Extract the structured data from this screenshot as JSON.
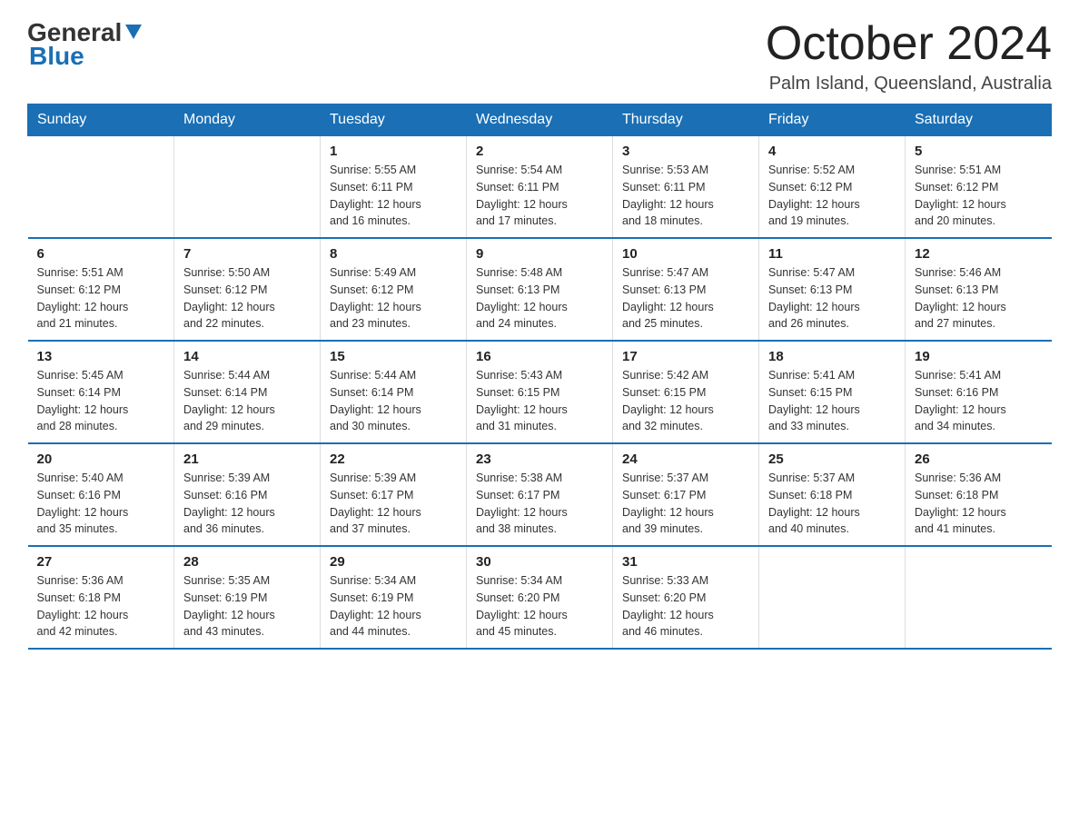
{
  "logo": {
    "general": "General",
    "blue": "Blue"
  },
  "title": "October 2024",
  "location": "Palm Island, Queensland, Australia",
  "days_of_week": [
    "Sunday",
    "Monday",
    "Tuesday",
    "Wednesday",
    "Thursday",
    "Friday",
    "Saturday"
  ],
  "weeks": [
    [
      {
        "num": "",
        "info": ""
      },
      {
        "num": "",
        "info": ""
      },
      {
        "num": "1",
        "info": "Sunrise: 5:55 AM\nSunset: 6:11 PM\nDaylight: 12 hours\nand 16 minutes."
      },
      {
        "num": "2",
        "info": "Sunrise: 5:54 AM\nSunset: 6:11 PM\nDaylight: 12 hours\nand 17 minutes."
      },
      {
        "num": "3",
        "info": "Sunrise: 5:53 AM\nSunset: 6:11 PM\nDaylight: 12 hours\nand 18 minutes."
      },
      {
        "num": "4",
        "info": "Sunrise: 5:52 AM\nSunset: 6:12 PM\nDaylight: 12 hours\nand 19 minutes."
      },
      {
        "num": "5",
        "info": "Sunrise: 5:51 AM\nSunset: 6:12 PM\nDaylight: 12 hours\nand 20 minutes."
      }
    ],
    [
      {
        "num": "6",
        "info": "Sunrise: 5:51 AM\nSunset: 6:12 PM\nDaylight: 12 hours\nand 21 minutes."
      },
      {
        "num": "7",
        "info": "Sunrise: 5:50 AM\nSunset: 6:12 PM\nDaylight: 12 hours\nand 22 minutes."
      },
      {
        "num": "8",
        "info": "Sunrise: 5:49 AM\nSunset: 6:12 PM\nDaylight: 12 hours\nand 23 minutes."
      },
      {
        "num": "9",
        "info": "Sunrise: 5:48 AM\nSunset: 6:13 PM\nDaylight: 12 hours\nand 24 minutes."
      },
      {
        "num": "10",
        "info": "Sunrise: 5:47 AM\nSunset: 6:13 PM\nDaylight: 12 hours\nand 25 minutes."
      },
      {
        "num": "11",
        "info": "Sunrise: 5:47 AM\nSunset: 6:13 PM\nDaylight: 12 hours\nand 26 minutes."
      },
      {
        "num": "12",
        "info": "Sunrise: 5:46 AM\nSunset: 6:13 PM\nDaylight: 12 hours\nand 27 minutes."
      }
    ],
    [
      {
        "num": "13",
        "info": "Sunrise: 5:45 AM\nSunset: 6:14 PM\nDaylight: 12 hours\nand 28 minutes."
      },
      {
        "num": "14",
        "info": "Sunrise: 5:44 AM\nSunset: 6:14 PM\nDaylight: 12 hours\nand 29 minutes."
      },
      {
        "num": "15",
        "info": "Sunrise: 5:44 AM\nSunset: 6:14 PM\nDaylight: 12 hours\nand 30 minutes."
      },
      {
        "num": "16",
        "info": "Sunrise: 5:43 AM\nSunset: 6:15 PM\nDaylight: 12 hours\nand 31 minutes."
      },
      {
        "num": "17",
        "info": "Sunrise: 5:42 AM\nSunset: 6:15 PM\nDaylight: 12 hours\nand 32 minutes."
      },
      {
        "num": "18",
        "info": "Sunrise: 5:41 AM\nSunset: 6:15 PM\nDaylight: 12 hours\nand 33 minutes."
      },
      {
        "num": "19",
        "info": "Sunrise: 5:41 AM\nSunset: 6:16 PM\nDaylight: 12 hours\nand 34 minutes."
      }
    ],
    [
      {
        "num": "20",
        "info": "Sunrise: 5:40 AM\nSunset: 6:16 PM\nDaylight: 12 hours\nand 35 minutes."
      },
      {
        "num": "21",
        "info": "Sunrise: 5:39 AM\nSunset: 6:16 PM\nDaylight: 12 hours\nand 36 minutes."
      },
      {
        "num": "22",
        "info": "Sunrise: 5:39 AM\nSunset: 6:17 PM\nDaylight: 12 hours\nand 37 minutes."
      },
      {
        "num": "23",
        "info": "Sunrise: 5:38 AM\nSunset: 6:17 PM\nDaylight: 12 hours\nand 38 minutes."
      },
      {
        "num": "24",
        "info": "Sunrise: 5:37 AM\nSunset: 6:17 PM\nDaylight: 12 hours\nand 39 minutes."
      },
      {
        "num": "25",
        "info": "Sunrise: 5:37 AM\nSunset: 6:18 PM\nDaylight: 12 hours\nand 40 minutes."
      },
      {
        "num": "26",
        "info": "Sunrise: 5:36 AM\nSunset: 6:18 PM\nDaylight: 12 hours\nand 41 minutes."
      }
    ],
    [
      {
        "num": "27",
        "info": "Sunrise: 5:36 AM\nSunset: 6:18 PM\nDaylight: 12 hours\nand 42 minutes."
      },
      {
        "num": "28",
        "info": "Sunrise: 5:35 AM\nSunset: 6:19 PM\nDaylight: 12 hours\nand 43 minutes."
      },
      {
        "num": "29",
        "info": "Sunrise: 5:34 AM\nSunset: 6:19 PM\nDaylight: 12 hours\nand 44 minutes."
      },
      {
        "num": "30",
        "info": "Sunrise: 5:34 AM\nSunset: 6:20 PM\nDaylight: 12 hours\nand 45 minutes."
      },
      {
        "num": "31",
        "info": "Sunrise: 5:33 AM\nSunset: 6:20 PM\nDaylight: 12 hours\nand 46 minutes."
      },
      {
        "num": "",
        "info": ""
      },
      {
        "num": "",
        "info": ""
      }
    ]
  ]
}
